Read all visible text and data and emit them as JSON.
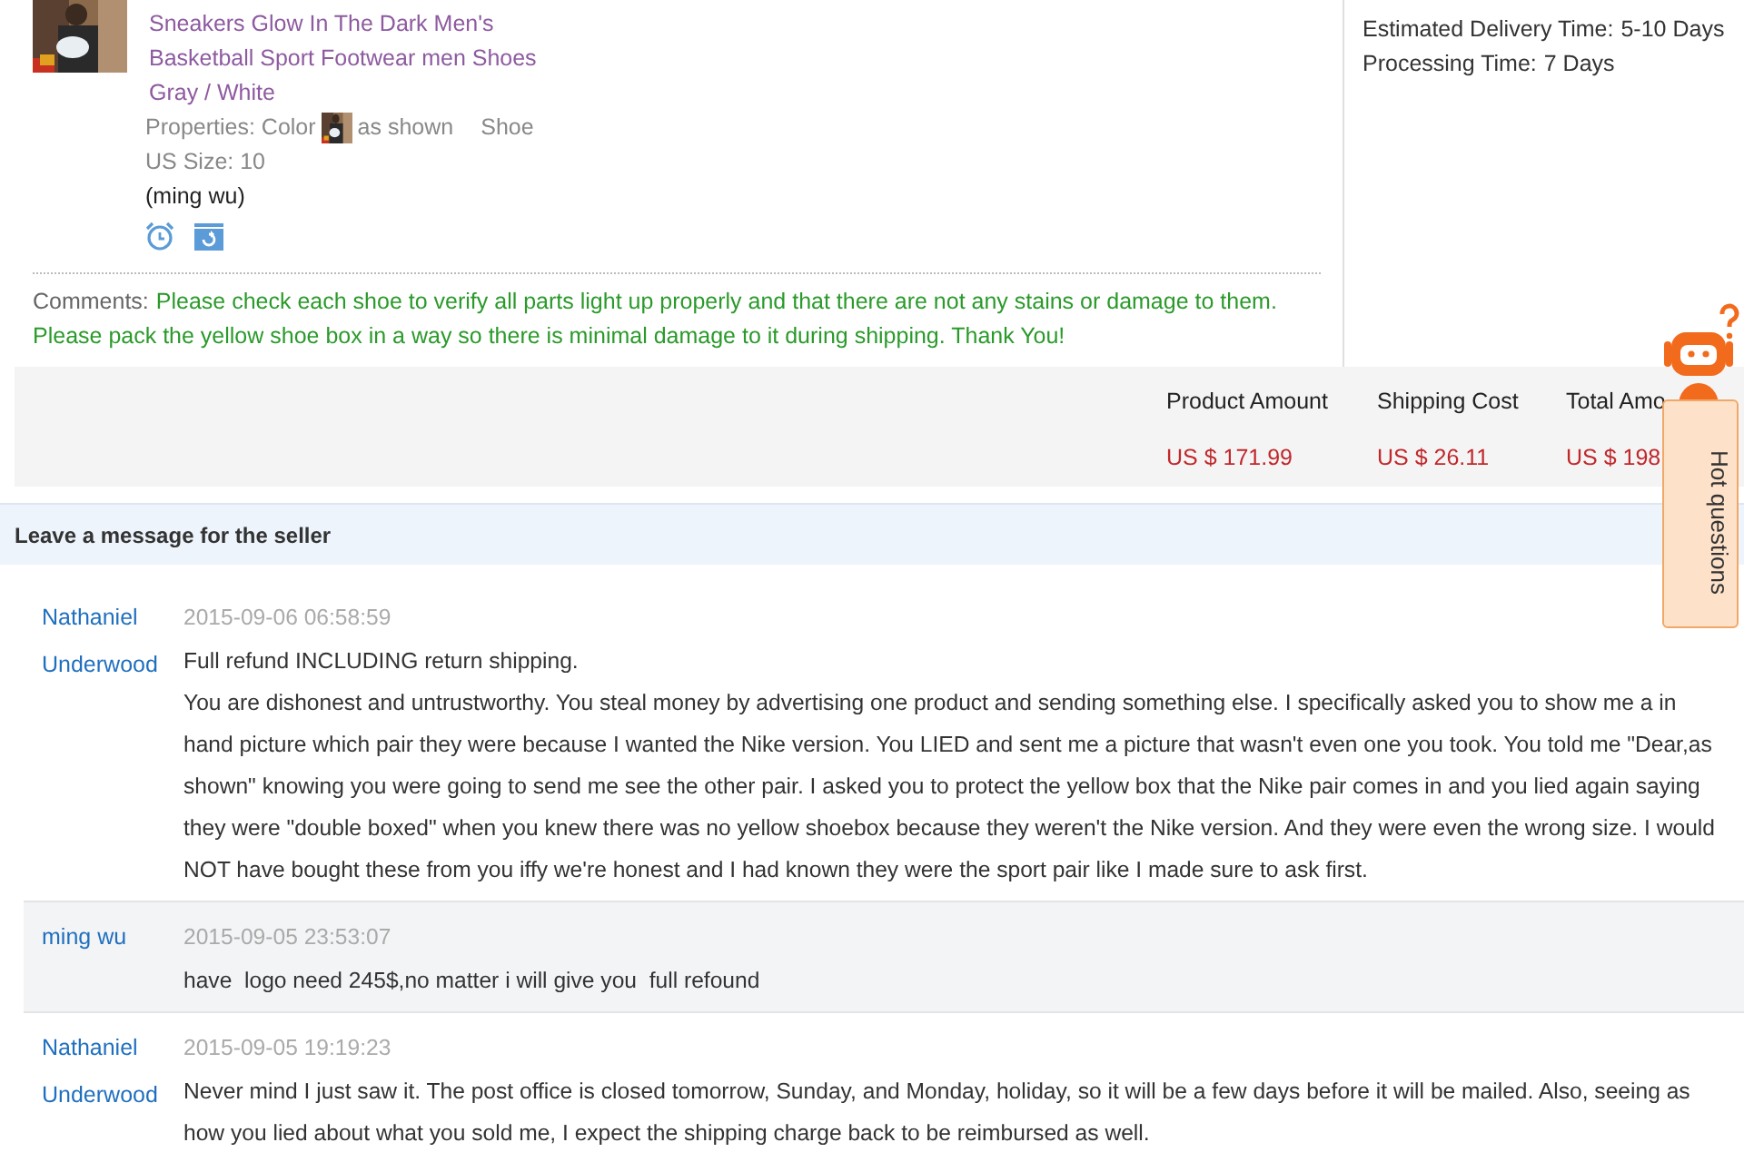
{
  "product": {
    "title_lines": [
      "Sneakers Glow In The Dark Men's",
      "Basketball Sport Footwear men Shoes",
      "Gray / White"
    ],
    "properties_label": "Properties: Color",
    "properties_value": "as shown",
    "properties_extra": "Shoe",
    "size": "US Size: 10",
    "buyer": "(ming wu)"
  },
  "delivery": [
    {
      "label": "Estimated Delivery Time:",
      "value": "5-10 Days"
    },
    {
      "label": "Processing Time:",
      "value": "7 Days"
    }
  ],
  "comments": {
    "label": "Comments:",
    "lines": [
      "Please check each shoe to verify all parts light up properly and that there are not any stains or damage to them.",
      "Please pack the yellow shoe box in a way so there is minimal damage to it during shipping. Thank You!"
    ]
  },
  "summary": [
    {
      "label": "Product Amount",
      "value": "US $ 171.99"
    },
    {
      "label": "Shipping Cost",
      "value": "US $ 26.11"
    },
    {
      "label": "Total Amo",
      "value": "US $ 198"
    }
  ],
  "messages_header": "Leave a message for the seller",
  "messages": [
    {
      "author_lines": [
        "Nathaniel",
        "Underwood"
      ],
      "time": "2015-09-06 06:58:59",
      "shaded": false,
      "paragraphs": [
        "Full refund INCLUDING return shipping.",
        "You are dishonest and untrustworthy. You steal money by advertising one product and sending something else. I specifically asked you to show me a in hand picture which pair they were because I wanted the Nike version. You LIED and sent me a picture that wasn't even one you took. You told me \"Dear,as shown\" knowing you were going to send me see the other pair. I asked you to protect the yellow box that the Nike pair comes in and you lied again saying they were \"double boxed\" when you knew there was no yellow shoebox because they weren't the Nike version. And they were even the wrong size. I would NOT have bought these from you iffy we're honest and I had known they were the sport pair like I made sure to ask first."
      ]
    },
    {
      "author_lines": [
        "ming wu"
      ],
      "time": "2015-09-05 23:53:07",
      "shaded": true,
      "paragraphs": [
        "have  logo need 245$,no matter i will give you  full refound"
      ]
    },
    {
      "author_lines": [
        "Nathaniel",
        "Underwood"
      ],
      "time": "2015-09-05 19:19:23",
      "shaded": false,
      "paragraphs": [
        "Never mind I just saw it. The post office is closed tomorrow, Sunday, and Monday, holiday, so it will be a few days before it will be mailed. Also, seeing as how you lied about what you sold me, I expect the shipping charge back to be reimbursed as well."
      ]
    }
  ],
  "help_widget": {
    "label": "Hot questions"
  }
}
